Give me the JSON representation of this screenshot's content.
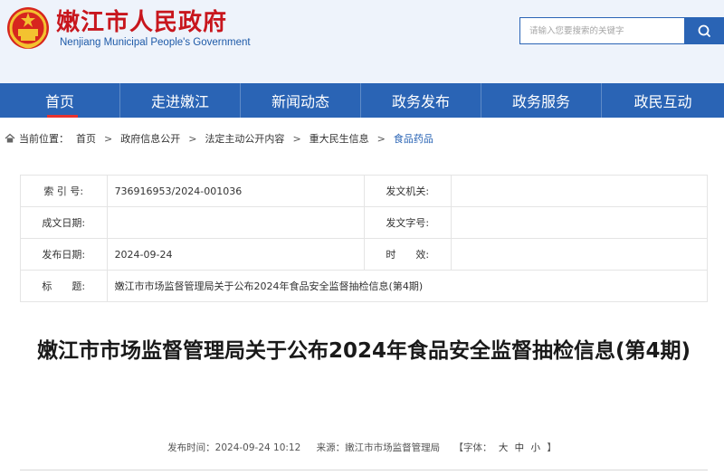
{
  "header": {
    "title": "嫩江市人民政府",
    "subtitle": "Nenjiang Municipal People's Government",
    "search_placeholder": "请输入您要搜索的关键字"
  },
  "nav": {
    "items": [
      {
        "label": "首页"
      },
      {
        "label": "走进嫩江"
      },
      {
        "label": "新闻动态"
      },
      {
        "label": "政务发布"
      },
      {
        "label": "政务服务"
      },
      {
        "label": "政民互动"
      }
    ]
  },
  "breadcrumb": {
    "prefix": "当前位置：",
    "items": [
      "首页",
      "政府信息公开",
      "法定主动公开内容",
      "重大民生信息",
      "食品药品"
    ],
    "separator": ">"
  },
  "meta": {
    "index_label": "索 引 号:",
    "index_value": "736916953/2024-001036",
    "issuer_label": "发文机关:",
    "issuer_value": "",
    "date_written_label": "成文日期:",
    "date_written_value": "",
    "doc_no_label": "发文字号:",
    "doc_no_value": "",
    "publish_date_label": "发布日期:",
    "publish_date_value": "2024-09-24",
    "validity_label": "时　　效:",
    "validity_value": "",
    "subject_label": "标　　题:",
    "subject_value": "嫩江市市场监督管理局关于公布2024年食品安全监督抽检信息(第4期)"
  },
  "article": {
    "title": "嫩江市市场监督管理局关于公布2024年食品安全监督抽检信息(第4期)"
  },
  "pub_info": {
    "time_label": "发布时间：2024-09-24 10:12",
    "source_label": "来源：嫩江市市场监督管理局",
    "font_open": "【字体：",
    "font_large": "大",
    "font_medium": "中",
    "font_small": "小",
    "font_close": "】"
  },
  "colors": {
    "brand_blue": "#2a64b5",
    "title_red": "#c8161d",
    "active_underline": "#e8322e"
  }
}
